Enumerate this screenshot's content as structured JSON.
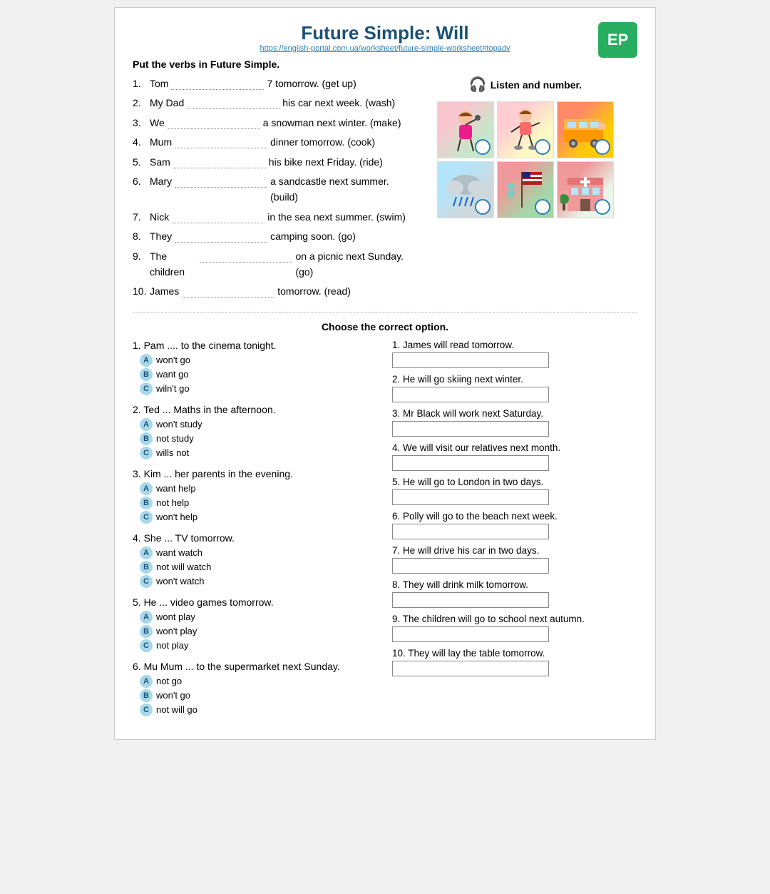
{
  "header": {
    "title": "Future Simple: Will",
    "url": "https://english-portal.com.ua/worksheet/future-simple-worksheet#topadv",
    "badge": "EP"
  },
  "section1": {
    "instruction": "Put the verbs in Future Simple.",
    "items": [
      {
        "num": "1.",
        "before": "Tom",
        "after": "7 tomorrow. (get up)"
      },
      {
        "num": "2.",
        "before": "My Dad",
        "after": "his car next week. (wash)"
      },
      {
        "num": "3.",
        "before": "We",
        "after": "a snowman next winter. (make)"
      },
      {
        "num": "4.",
        "before": "Mum",
        "after": "dinner tomorrow. (cook)"
      },
      {
        "num": "5.",
        "before": "Sam",
        "after": "his bike next Friday. (ride)"
      },
      {
        "num": "6.",
        "before": "Mary",
        "after": "a sandcastle next summer. (build)"
      },
      {
        "num": "7.",
        "before": "Nick",
        "after": "in the sea next summer. (swim)"
      },
      {
        "num": "8.",
        "before": "They",
        "after": "camping soon. (go)"
      },
      {
        "num": "9.",
        "before": "The children",
        "after": "on a picnic next Sunday. (go)"
      },
      {
        "num": "10.",
        "before": "James",
        "after": "tomorrow. (read)"
      }
    ]
  },
  "listen_section": {
    "label": "Listen and number."
  },
  "choose_section": {
    "instruction": "Choose the correct option.",
    "questions": [
      {
        "num": "1.",
        "text": "Pam .... to the cinema tonight.",
        "options": [
          {
            "letter": "A",
            "text": "won't go"
          },
          {
            "letter": "B",
            "text": "want go"
          },
          {
            "letter": "C",
            "text": "wiln't go"
          }
        ]
      },
      {
        "num": "2.",
        "text": "Ted ... Maths in the afternoon.",
        "options": [
          {
            "letter": "A",
            "text": "won't study"
          },
          {
            "letter": "B",
            "text": "not study"
          },
          {
            "letter": "C",
            "text": "wills not"
          }
        ]
      },
      {
        "num": "3.",
        "text": "Kim ... her parents in the evening.",
        "options": [
          {
            "letter": "A",
            "text": "want help"
          },
          {
            "letter": "B",
            "text": "not help"
          },
          {
            "letter": "C",
            "text": "won't help"
          }
        ]
      },
      {
        "num": "4.",
        "text": "She ... TV tomorrow.",
        "options": [
          {
            "letter": "A",
            "text": "want watch"
          },
          {
            "letter": "B",
            "text": "not will watch"
          },
          {
            "letter": "C",
            "text": "won't watch"
          }
        ]
      },
      {
        "num": "5.",
        "text": "He ... video games tomorrow.",
        "options": [
          {
            "letter": "A",
            "text": "wont play"
          },
          {
            "letter": "B",
            "text": "won't play"
          },
          {
            "letter": "C",
            "text": "not play"
          }
        ]
      },
      {
        "num": "6.",
        "text": "Mu Mum ... to the supermarket next Sunday.",
        "options": [
          {
            "letter": "A",
            "text": "not go"
          },
          {
            "letter": "B",
            "text": "won't go"
          },
          {
            "letter": "C",
            "text": "not will go"
          }
        ]
      }
    ]
  },
  "matching_section": {
    "items": [
      {
        "num": "1.",
        "text": "James will read tomorrow."
      },
      {
        "num": "2.",
        "text": "He will go skiing next winter."
      },
      {
        "num": "3.",
        "text": "Mr Black will work next Saturday."
      },
      {
        "num": "4.",
        "text": "We will visit our relatives next month."
      },
      {
        "num": "5.",
        "text": "He will go to London in two days."
      },
      {
        "num": "6.",
        "text": "Polly will go to the beach next week."
      },
      {
        "num": "7.",
        "text": "He will drive his car in two days."
      },
      {
        "num": "8.",
        "text": "They will drink milk tomorrow."
      },
      {
        "num": "9.",
        "text": "The children will go to school next autumn."
      },
      {
        "num": "10.",
        "text": "They will lay the table tomorrow."
      }
    ]
  }
}
